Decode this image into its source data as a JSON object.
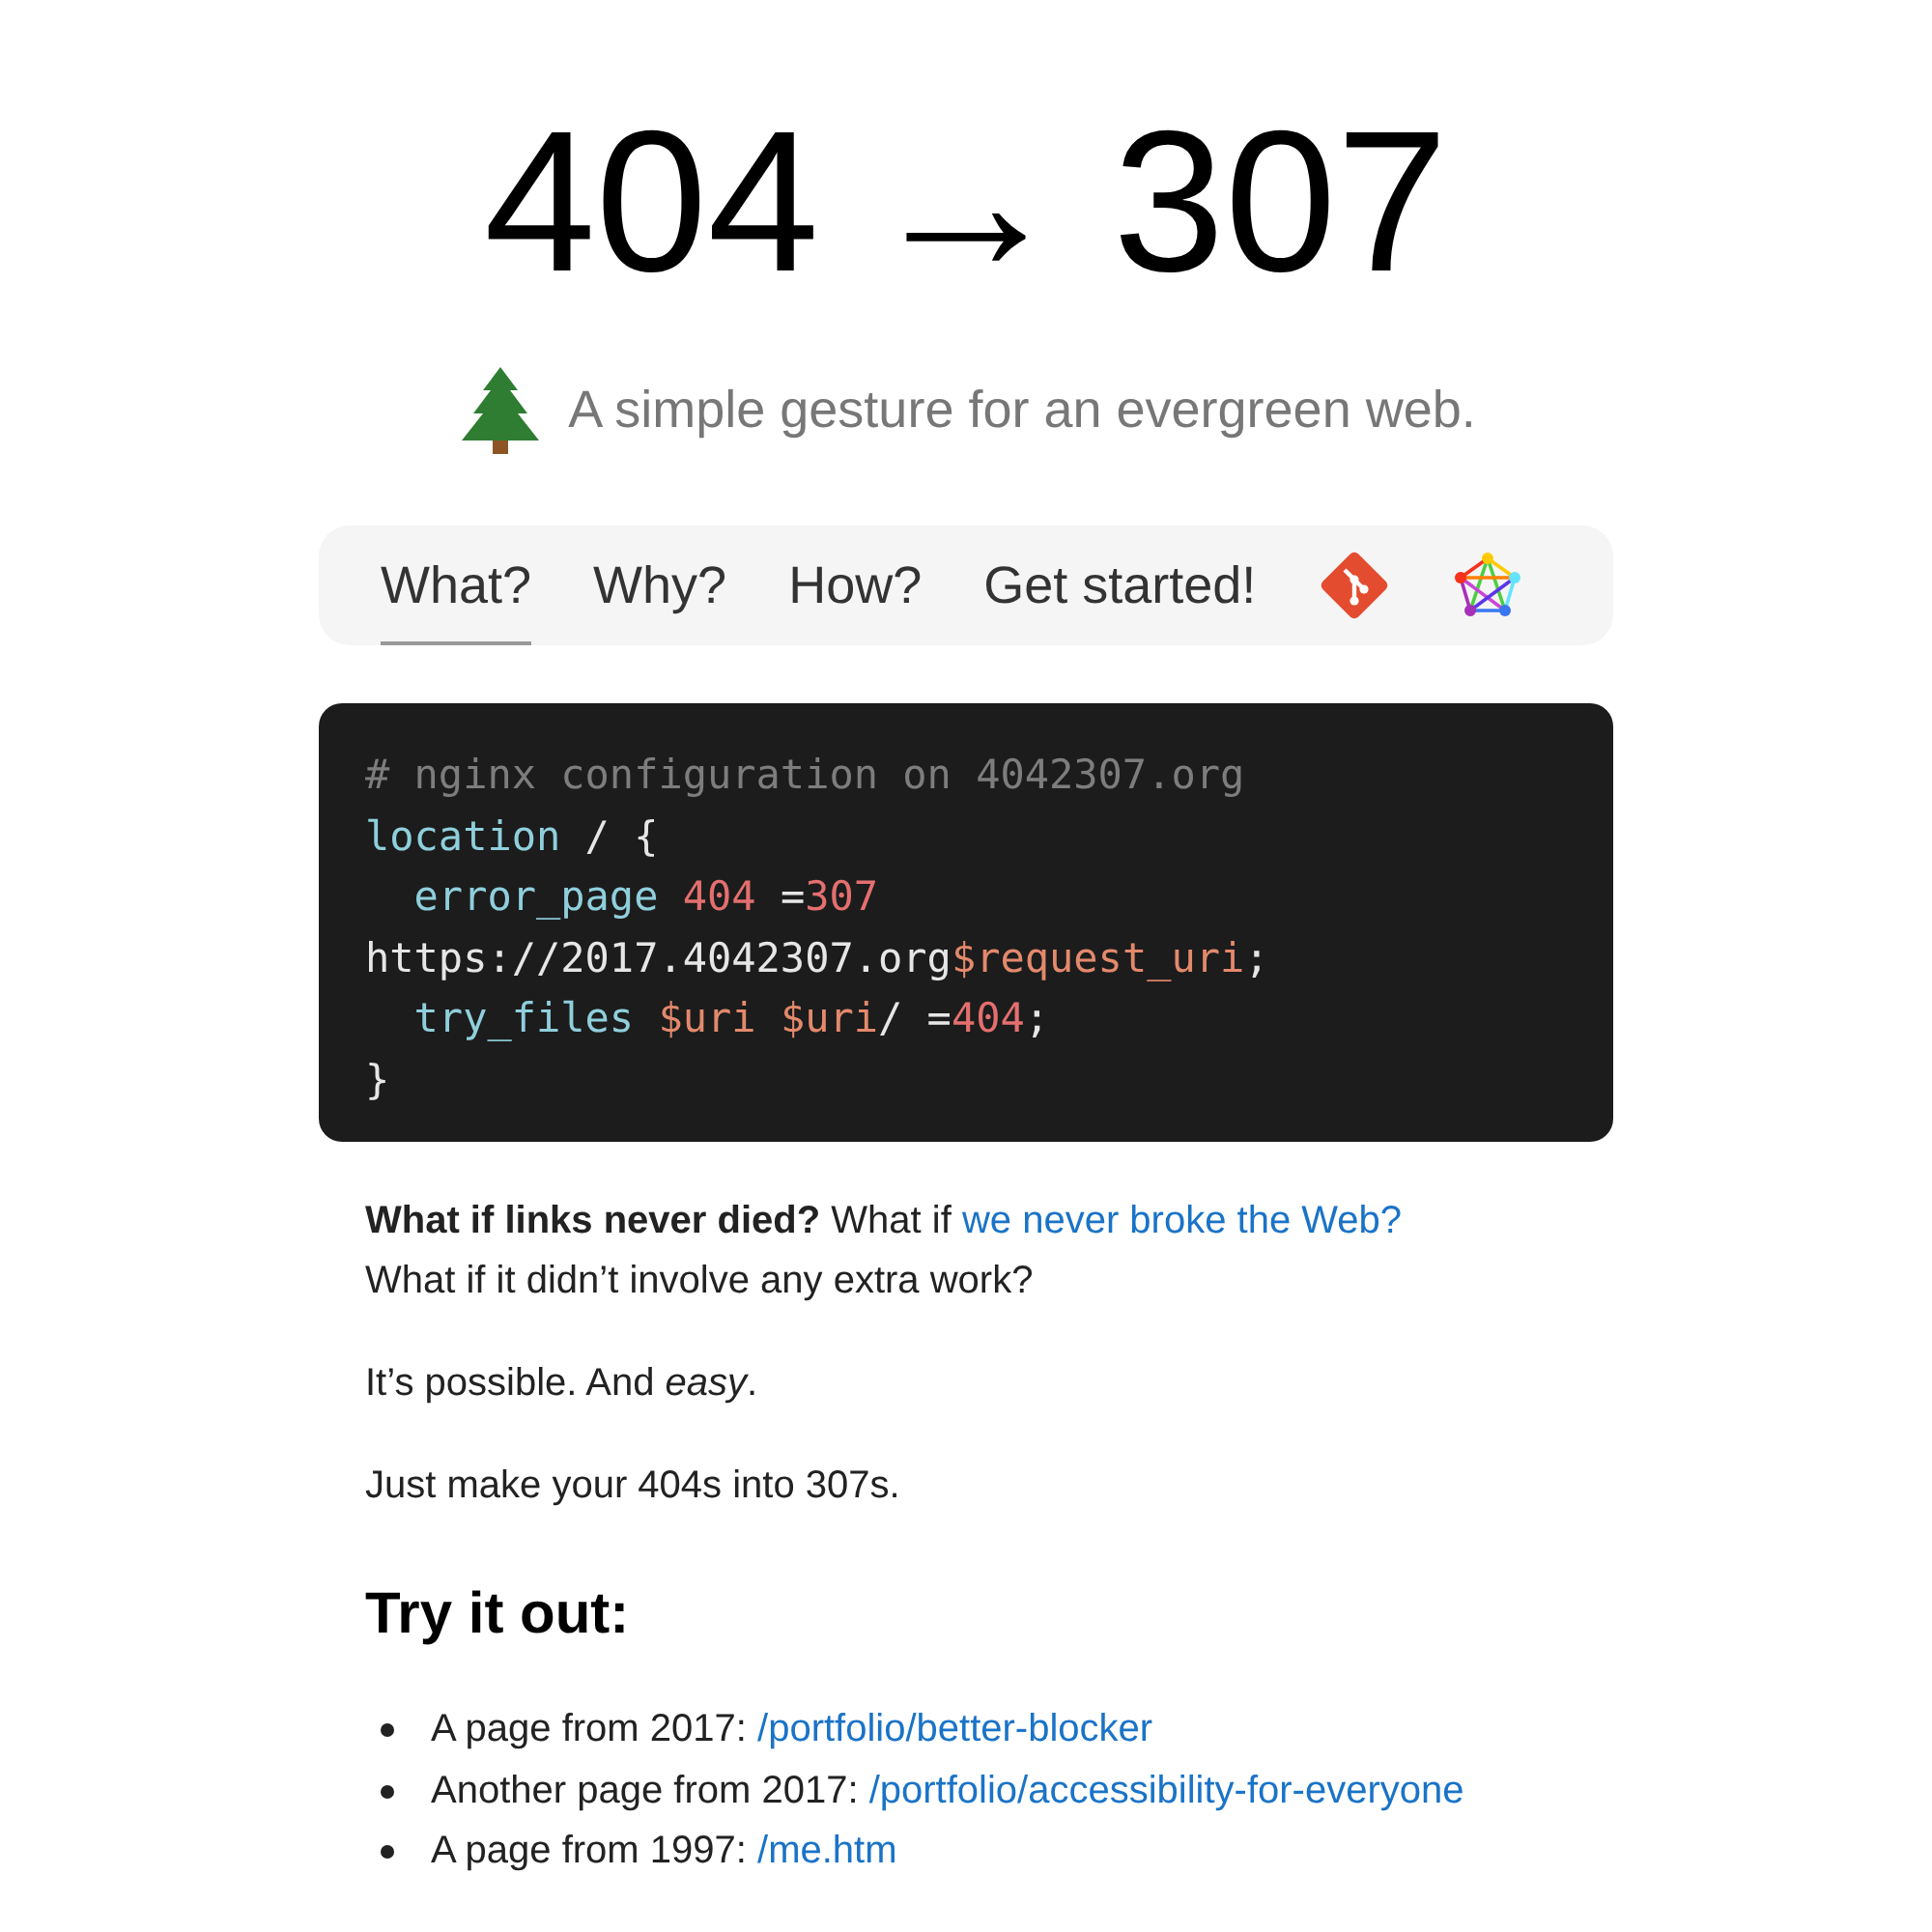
{
  "title": {
    "from": "404",
    "arrow": "→",
    "to": "307"
  },
  "tagline": "A simple gesture for an evergreen web.",
  "nav": {
    "tabs": [
      {
        "label": "What?",
        "selected": true
      },
      {
        "label": "Why?",
        "selected": false
      },
      {
        "label": "How?",
        "selected": false
      },
      {
        "label": "Get started!",
        "selected": false
      }
    ],
    "icons": [
      {
        "kind": "git"
      },
      {
        "kind": "fediverse"
      }
    ]
  },
  "code": [
    [
      {
        "kind": "comment",
        "text": "# nginx configuration on 4042307.org"
      }
    ],
    [
      {
        "kind": "keyword",
        "text": "location"
      },
      {
        "kind": "plain",
        "text": " / {"
      }
    ],
    [
      {
        "kind": "keyword",
        "text": "  error_page"
      },
      {
        "kind": "number",
        "text": " 404"
      },
      {
        "kind": "plain",
        "text": " ="
      },
      {
        "kind": "number",
        "text": "307"
      }
    ],
    [
      {
        "kind": "plain",
        "text": "https://2017.4042307.org"
      },
      {
        "kind": "variable",
        "text": "$request_uri"
      },
      {
        "kind": "plain",
        "text": ";"
      }
    ],
    [
      {
        "kind": "keyword",
        "text": "  try_files"
      },
      {
        "kind": "variable",
        "text": " $uri"
      },
      {
        "kind": "variable",
        "text": " $uri"
      },
      {
        "kind": "plain",
        "text": "/ ="
      },
      {
        "kind": "number",
        "text": "404"
      },
      {
        "kind": "plain",
        "text": ";"
      }
    ],
    [
      {
        "kind": "plain",
        "text": "}"
      }
    ]
  ],
  "paragraphs": [
    [
      {
        "kind": "text",
        "text": "**What if links never died?** What if "
      },
      {
        "kind": "link",
        "text": "we never broke the Web?"
      },
      {
        "kind": "text",
        "text": " What if it didn’t involve any extra work?"
      }
    ],
    [
      {
        "kind": "text",
        "text": "It’s possible. And *easy*."
      }
    ],
    [
      {
        "kind": "text",
        "text": "Just make your 404s into 307s."
      }
    ]
  ],
  "heading": "Try it out:",
  "examples": [
    {
      "text": "A page from 2017: ",
      "link": "/portfolio/better-blocker"
    },
    {
      "text": "Another page from 2017: ",
      "link": "/portfolio/accessibility-for-everyone"
    },
    {
      "text": "A page from 1997: ",
      "link": "/me.htm"
    }
  ]
}
